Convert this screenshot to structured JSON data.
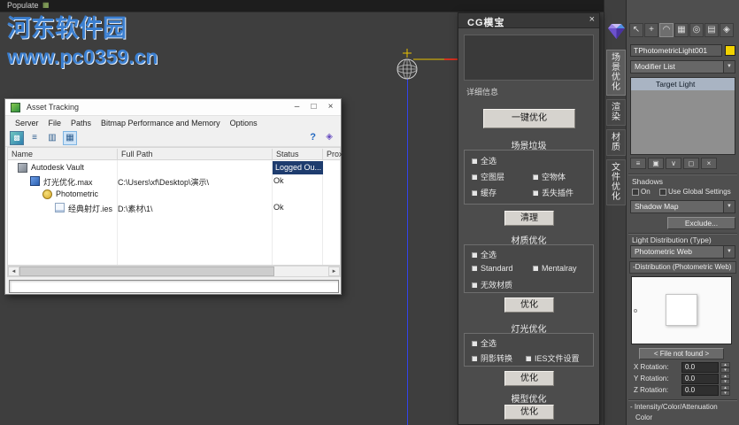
{
  "colors": {
    "watermark_blue": "#3b7fd0",
    "status_selected": "#1e3c6e",
    "swatch_yellow": "#f2d200",
    "target_line_blue": "#3344ee"
  },
  "top_menu": {
    "populate": "Populate"
  },
  "watermark": {
    "title": "河东软件园",
    "url": "www.pc0359.cn"
  },
  "icons": {
    "workspace": "▦",
    "help": "?",
    "flag": "◈",
    "min": "–",
    "max": "□",
    "close": "×",
    "dropdown": "▼",
    "scroll_left": "◄",
    "scroll_right": "►",
    "spin_up": "▴",
    "spin_down": "▾",
    "toolbar_new": "▩",
    "toolbar_list": "≡",
    "toolbar_columns": "▥",
    "toolbar_table": "▦",
    "command_tabs": [
      "↖",
      "+",
      "◠",
      "▦",
      "◎",
      "▤",
      "◈"
    ],
    "stack_tools": [
      "≡",
      "▣",
      "∨",
      "◻",
      "×"
    ]
  },
  "asset_tracking": {
    "title": "Asset Tracking",
    "menus": [
      "Server",
      "File",
      "Paths",
      "Bitmap Performance and Memory",
      "Options"
    ],
    "columns": [
      "Name",
      "Full Path",
      "Status",
      "Prox"
    ],
    "rows": [
      {
        "name": "Autodesk Vault",
        "path": "",
        "status": "Logged Ou..."
      },
      {
        "name": "灯光优化.max",
        "path": "C:\\Users\\xf\\Desktop\\演示\\",
        "status": "Ok"
      },
      {
        "name": "Photometric",
        "path": "",
        "status": ""
      },
      {
        "name": "经典射灯.ies",
        "path": "D:\\素材\\1\\",
        "status": "Ok"
      }
    ]
  },
  "cg_panel": {
    "title": "CG模宝",
    "info_label": "详细信息",
    "one_key_button": "一键优化",
    "scene": {
      "title": "场景垃圾",
      "cb_all": "全选",
      "cb_empty_layer": "空图层",
      "cb_empty_object": "空物体",
      "cb_cache": "缓存",
      "cb_missing_plugin": "丢失插件",
      "button": "清理"
    },
    "material": {
      "title": "材质优化",
      "cb_all": "全选",
      "cb_standard": "Standard",
      "cb_mentalray": "Mentalray",
      "cb_invalid": "无效材质",
      "button": "优化"
    },
    "light": {
      "title": "灯光优化",
      "cb_all": "全选",
      "cb_shadow": "阴影转换",
      "cb_ies": "IES文件设置",
      "button": "优化"
    },
    "model": {
      "title": "模型优化",
      "button": "优化"
    }
  },
  "side_tabs": [
    {
      "label": "场景优化"
    },
    {
      "label": "渲染"
    },
    {
      "label": "材质"
    },
    {
      "label": "文件优化"
    }
  ],
  "command_panel": {
    "light_name": "TPhotometricLight001",
    "modifier_list": "Modifier List",
    "stack_item": "Target Light",
    "shadows_title": "Shadows",
    "shadow_on": "On",
    "shadow_global": "Use Global Settings",
    "shadow_type": "Shadow Map",
    "exclude_button": "Exclude...",
    "dist_label": "Light Distribution (Type)",
    "dist_value": "Photometric Web",
    "dist_rollout": "-Distribution (Photometric Web)",
    "file_button": "< File not found >",
    "rot_x_label": "X Rotation:",
    "rot_x_value": "0.0",
    "rot_y_label": "Y Rotation:",
    "rot_y_value": "0.0",
    "rot_z_label": "Z Rotation:",
    "rot_z_value": "0.0",
    "bottom_rollout": "- Intensity/Color/Attenuation",
    "bottom_sub": "Color"
  }
}
